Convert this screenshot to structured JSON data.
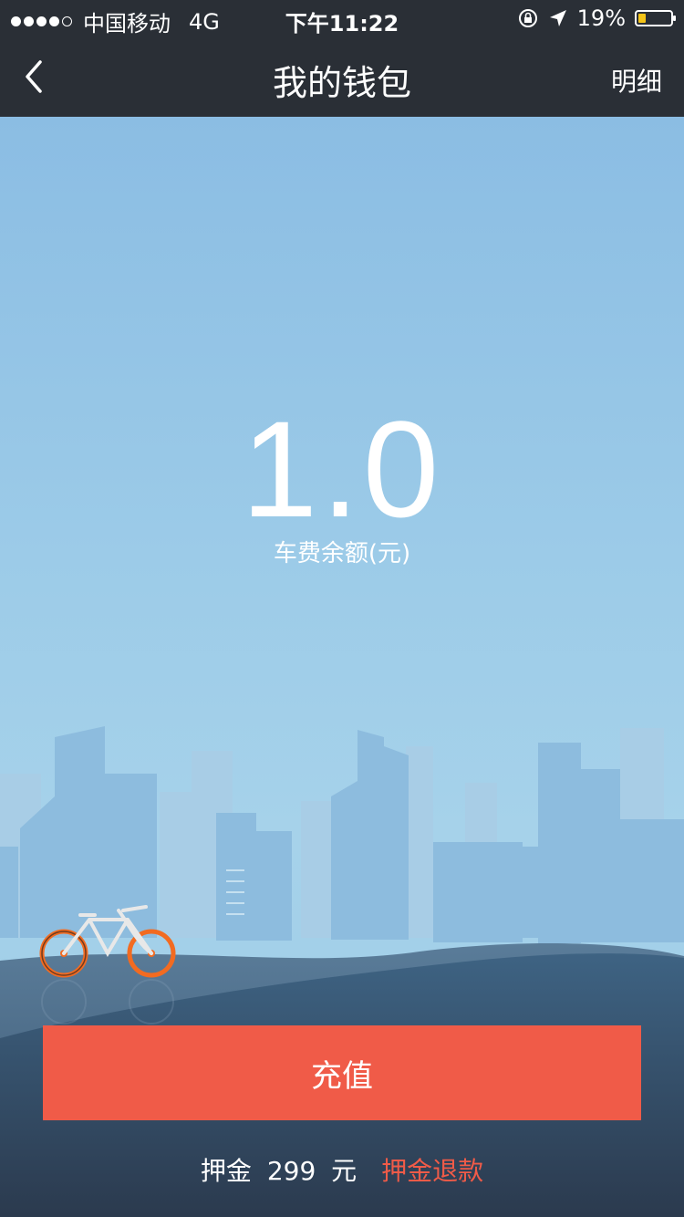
{
  "status_bar": {
    "carrier": "中国移动",
    "network": "4G",
    "time": "下午11:22",
    "battery": "19%",
    "battery_color": "#f5c518",
    "icons": [
      "signal-dots",
      "rotation-lock-icon",
      "location-arrow-icon",
      "battery-icon"
    ]
  },
  "nav": {
    "title": "我的钱包",
    "detail_label": "明细",
    "back_icon": "chevron-left-icon",
    "background": "#2a2f36"
  },
  "wallet": {
    "balance": "1.0",
    "balance_label": "车费余额(元)"
  },
  "actions": {
    "recharge_label": "充值",
    "accent_color": "#f05b48"
  },
  "deposit": {
    "label": "押金",
    "amount": "299",
    "unit": "元",
    "refund_label": "押金退款"
  },
  "illustration": {
    "description_icons": [
      "city-skyline",
      "bicycle-icon",
      "hill"
    ],
    "wheel_color": "#f26b21"
  }
}
